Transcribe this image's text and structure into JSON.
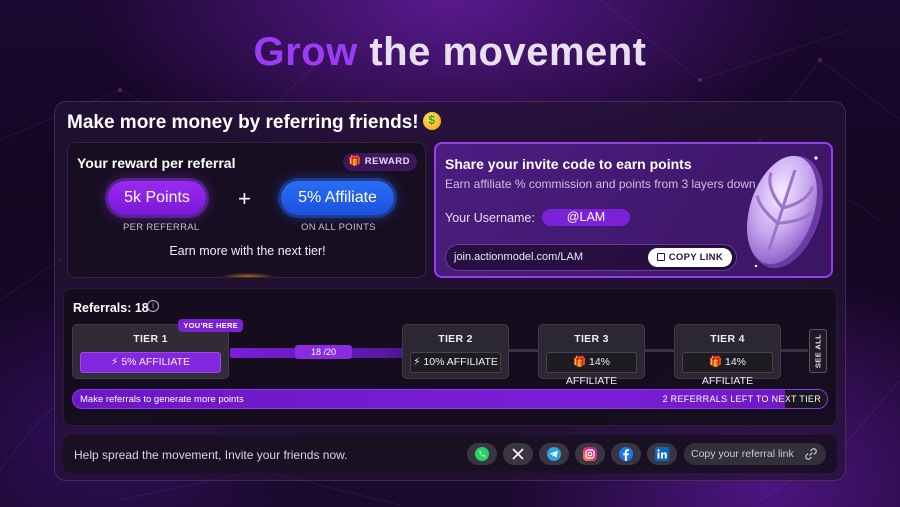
{
  "headline": {
    "accent": "Grow",
    "rest": " the movement"
  },
  "main": {
    "title": "Make more money by referring friends!"
  },
  "reward": {
    "title": "Your reward per referral",
    "badge": "REWARD",
    "points": "5k Points",
    "points_label": "PER REFERRAL",
    "plus": "+",
    "affiliate": "5% Affiliate",
    "affiliate_label": "ON ALL POINTS",
    "earn_more": "Earn more with the next tier!"
  },
  "share": {
    "title": "Share your invite code to earn points",
    "subtitle": "Earn affiliate % commission and points from 3 layers down",
    "username_label": "Your Username:",
    "username": "@LAM",
    "link": "join.actionmodel.com/LAM",
    "copy_label": "COPY LINK"
  },
  "referrals": {
    "title": "Referrals: 18",
    "progress": "18 /20",
    "progress_value": 18,
    "progress_max": 20,
    "here_badge": "YOU'RE HERE",
    "tiers": [
      {
        "name": "TIER 1",
        "reward": "5% AFFILIATE",
        "icon": "bolt-icon"
      },
      {
        "name": "TIER 2",
        "reward": "10% AFFILIATE",
        "icon": "bolt-icon"
      },
      {
        "name": "TIER 3",
        "reward": "14% AFFILIATE",
        "icon": "gift-icon"
      },
      {
        "name": "TIER 4",
        "reward": "14% AFFILIATE",
        "icon": "gift-icon"
      }
    ],
    "see_all": "SEE ALL",
    "bar_left": "Make referrals to generate more points",
    "bar_right": "2  REFERRALS LEFT TO NEXT TIER"
  },
  "footer": {
    "text": "Help spread the movement, Invite your friends now.",
    "socials": [
      "whatsapp-icon",
      "x-icon",
      "telegram-icon",
      "instagram-icon",
      "facebook-icon",
      "linkedin-icon"
    ],
    "copy_ref": "Copy your referral link"
  },
  "colors": {
    "accent": "#9b3cf5",
    "blue": "#2a6ef5",
    "bg": "#1b0830"
  }
}
